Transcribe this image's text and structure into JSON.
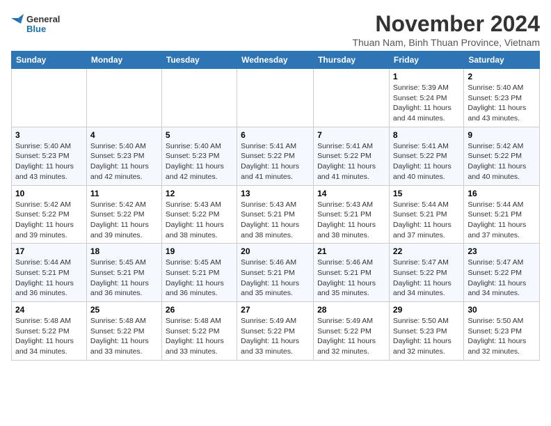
{
  "header": {
    "logo_general": "General",
    "logo_blue": "Blue",
    "month_title": "November 2024",
    "subtitle": "Thuan Nam, Binh Thuan Province, Vietnam"
  },
  "weekdays": [
    "Sunday",
    "Monday",
    "Tuesday",
    "Wednesday",
    "Thursday",
    "Friday",
    "Saturday"
  ],
  "weeks": [
    [
      {
        "day": "",
        "info": ""
      },
      {
        "day": "",
        "info": ""
      },
      {
        "day": "",
        "info": ""
      },
      {
        "day": "",
        "info": ""
      },
      {
        "day": "",
        "info": ""
      },
      {
        "day": "1",
        "info": "Sunrise: 5:39 AM\nSunset: 5:24 PM\nDaylight: 11 hours and 44 minutes."
      },
      {
        "day": "2",
        "info": "Sunrise: 5:40 AM\nSunset: 5:23 PM\nDaylight: 11 hours and 43 minutes."
      }
    ],
    [
      {
        "day": "3",
        "info": "Sunrise: 5:40 AM\nSunset: 5:23 PM\nDaylight: 11 hours and 43 minutes."
      },
      {
        "day": "4",
        "info": "Sunrise: 5:40 AM\nSunset: 5:23 PM\nDaylight: 11 hours and 42 minutes."
      },
      {
        "day": "5",
        "info": "Sunrise: 5:40 AM\nSunset: 5:23 PM\nDaylight: 11 hours and 42 minutes."
      },
      {
        "day": "6",
        "info": "Sunrise: 5:41 AM\nSunset: 5:22 PM\nDaylight: 11 hours and 41 minutes."
      },
      {
        "day": "7",
        "info": "Sunrise: 5:41 AM\nSunset: 5:22 PM\nDaylight: 11 hours and 41 minutes."
      },
      {
        "day": "8",
        "info": "Sunrise: 5:41 AM\nSunset: 5:22 PM\nDaylight: 11 hours and 40 minutes."
      },
      {
        "day": "9",
        "info": "Sunrise: 5:42 AM\nSunset: 5:22 PM\nDaylight: 11 hours and 40 minutes."
      }
    ],
    [
      {
        "day": "10",
        "info": "Sunrise: 5:42 AM\nSunset: 5:22 PM\nDaylight: 11 hours and 39 minutes."
      },
      {
        "day": "11",
        "info": "Sunrise: 5:42 AM\nSunset: 5:22 PM\nDaylight: 11 hours and 39 minutes."
      },
      {
        "day": "12",
        "info": "Sunrise: 5:43 AM\nSunset: 5:22 PM\nDaylight: 11 hours and 38 minutes."
      },
      {
        "day": "13",
        "info": "Sunrise: 5:43 AM\nSunset: 5:21 PM\nDaylight: 11 hours and 38 minutes."
      },
      {
        "day": "14",
        "info": "Sunrise: 5:43 AM\nSunset: 5:21 PM\nDaylight: 11 hours and 38 minutes."
      },
      {
        "day": "15",
        "info": "Sunrise: 5:44 AM\nSunset: 5:21 PM\nDaylight: 11 hours and 37 minutes."
      },
      {
        "day": "16",
        "info": "Sunrise: 5:44 AM\nSunset: 5:21 PM\nDaylight: 11 hours and 37 minutes."
      }
    ],
    [
      {
        "day": "17",
        "info": "Sunrise: 5:44 AM\nSunset: 5:21 PM\nDaylight: 11 hours and 36 minutes."
      },
      {
        "day": "18",
        "info": "Sunrise: 5:45 AM\nSunset: 5:21 PM\nDaylight: 11 hours and 36 minutes."
      },
      {
        "day": "19",
        "info": "Sunrise: 5:45 AM\nSunset: 5:21 PM\nDaylight: 11 hours and 36 minutes."
      },
      {
        "day": "20",
        "info": "Sunrise: 5:46 AM\nSunset: 5:21 PM\nDaylight: 11 hours and 35 minutes."
      },
      {
        "day": "21",
        "info": "Sunrise: 5:46 AM\nSunset: 5:21 PM\nDaylight: 11 hours and 35 minutes."
      },
      {
        "day": "22",
        "info": "Sunrise: 5:47 AM\nSunset: 5:22 PM\nDaylight: 11 hours and 34 minutes."
      },
      {
        "day": "23",
        "info": "Sunrise: 5:47 AM\nSunset: 5:22 PM\nDaylight: 11 hours and 34 minutes."
      }
    ],
    [
      {
        "day": "24",
        "info": "Sunrise: 5:48 AM\nSunset: 5:22 PM\nDaylight: 11 hours and 34 minutes."
      },
      {
        "day": "25",
        "info": "Sunrise: 5:48 AM\nSunset: 5:22 PM\nDaylight: 11 hours and 33 minutes."
      },
      {
        "day": "26",
        "info": "Sunrise: 5:48 AM\nSunset: 5:22 PM\nDaylight: 11 hours and 33 minutes."
      },
      {
        "day": "27",
        "info": "Sunrise: 5:49 AM\nSunset: 5:22 PM\nDaylight: 11 hours and 33 minutes."
      },
      {
        "day": "28",
        "info": "Sunrise: 5:49 AM\nSunset: 5:22 PM\nDaylight: 11 hours and 32 minutes."
      },
      {
        "day": "29",
        "info": "Sunrise: 5:50 AM\nSunset: 5:23 PM\nDaylight: 11 hours and 32 minutes."
      },
      {
        "day": "30",
        "info": "Sunrise: 5:50 AM\nSunset: 5:23 PM\nDaylight: 11 hours and 32 minutes."
      }
    ]
  ]
}
